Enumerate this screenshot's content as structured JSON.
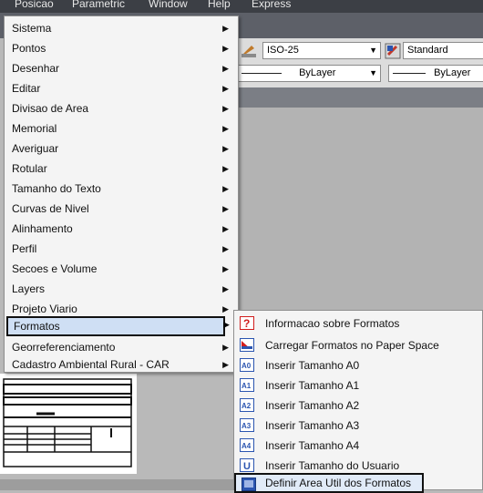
{
  "topbar": {
    "items": [
      "Posicao",
      "Parametric",
      "Window",
      "Help",
      "Express"
    ]
  },
  "ribbon": {
    "dimstyle": "ISO-25",
    "textstyle": "Standard",
    "linetype": "ByLayer",
    "lineweight": "ByLayer"
  },
  "menu": {
    "items": [
      {
        "label": "Sistema"
      },
      {
        "label": "Pontos"
      },
      {
        "label": "Desenhar"
      },
      {
        "label": "Editar"
      },
      {
        "label": "Divisao de Area"
      },
      {
        "label": "Memorial"
      },
      {
        "label": "Averiguar"
      },
      {
        "label": "Rotular"
      },
      {
        "label": "Tamanho do Texto"
      },
      {
        "label": "Curvas de Nivel"
      },
      {
        "label": "Alinhamento"
      },
      {
        "label": "Perfil"
      },
      {
        "label": "Secoes e Volume"
      },
      {
        "label": "Layers"
      },
      {
        "label": "Projeto Viario"
      },
      {
        "label": "Formatos"
      },
      {
        "label": "Georreferenciamento"
      },
      {
        "label": "Cadastro Ambiental Rural - CAR"
      }
    ],
    "selected": "Formatos"
  },
  "submenu": {
    "items": [
      {
        "label": "Informacao sobre Formatos",
        "icon": "help-icon"
      },
      {
        "label": "Carregar Formatos no Paper Space",
        "icon": "paper-space-icon"
      },
      {
        "label": "Inserir Tamanho A0",
        "icon": "a0-icon"
      },
      {
        "label": "Inserir Tamanho A1",
        "icon": "a1-icon"
      },
      {
        "label": "Inserir Tamanho A2",
        "icon": "a2-icon"
      },
      {
        "label": "Inserir Tamanho A3",
        "icon": "a3-icon"
      },
      {
        "label": "Inserir Tamanho A4",
        "icon": "a4-icon"
      },
      {
        "label": "Inserir Tamanho do Usuario",
        "icon": "user-size-icon"
      },
      {
        "label": "Definir Area Util dos Formatos",
        "icon": "define-area-icon"
      }
    ],
    "icon_text": [
      "?",
      "",
      "A0",
      "A1",
      "A2",
      "A3",
      "A4",
      "U",
      ""
    ],
    "selected": "Definir Area Util dos Formatos"
  },
  "colors": {
    "menu_bg": "#f4f4f4",
    "highlight": "#cfdff4",
    "icon_blue": "#2b55b0",
    "icon_red": "#d11d1d"
  }
}
